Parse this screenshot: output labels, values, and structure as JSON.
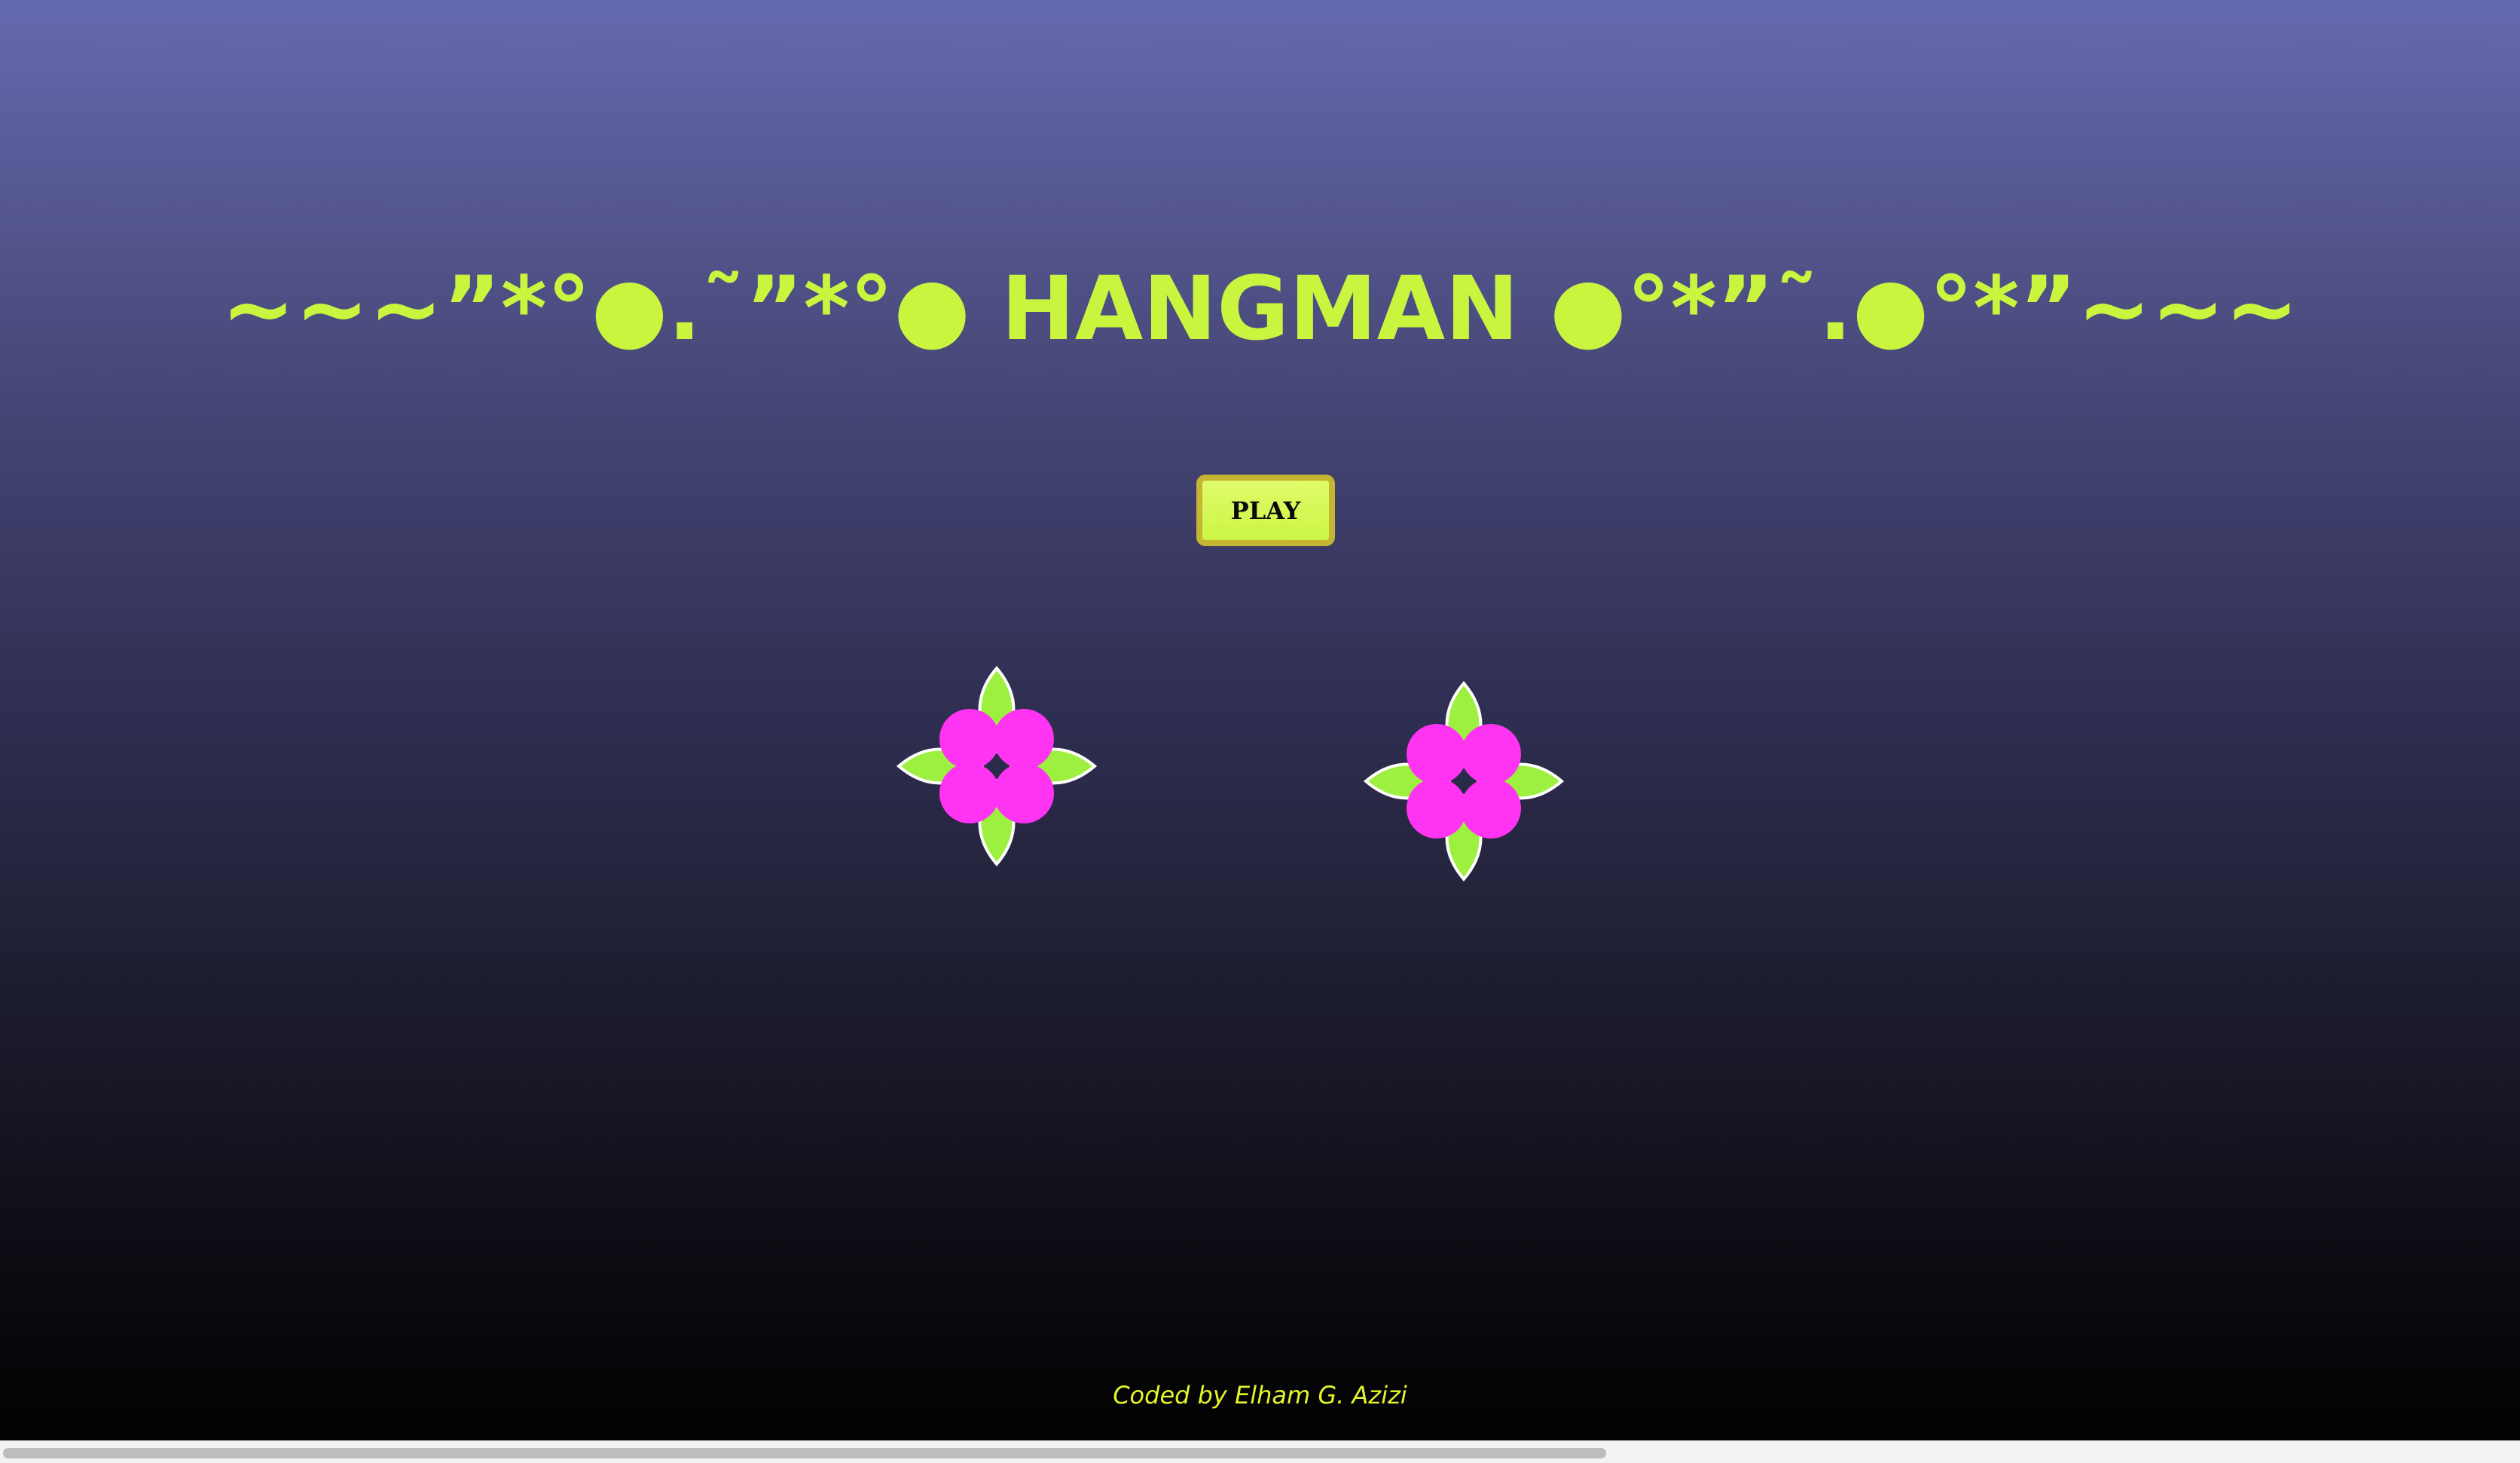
{
  "page": {
    "title": "~~~”*°●.˜”*°● HANGMAN ●°*”˜.●°*”~~~",
    "play_label": "PLAY",
    "footer": "Coded by Elham G. Azizi"
  },
  "decorations": [
    {
      "name": "flower-left-icon"
    },
    {
      "name": "flower-right-icon"
    }
  ],
  "colors": {
    "accent": "#c9f53f",
    "petal_pink": "#ff33f2",
    "leaf_green": "#9df03f",
    "button_border": "#c4b533",
    "footer_text": "#e4f52a"
  }
}
